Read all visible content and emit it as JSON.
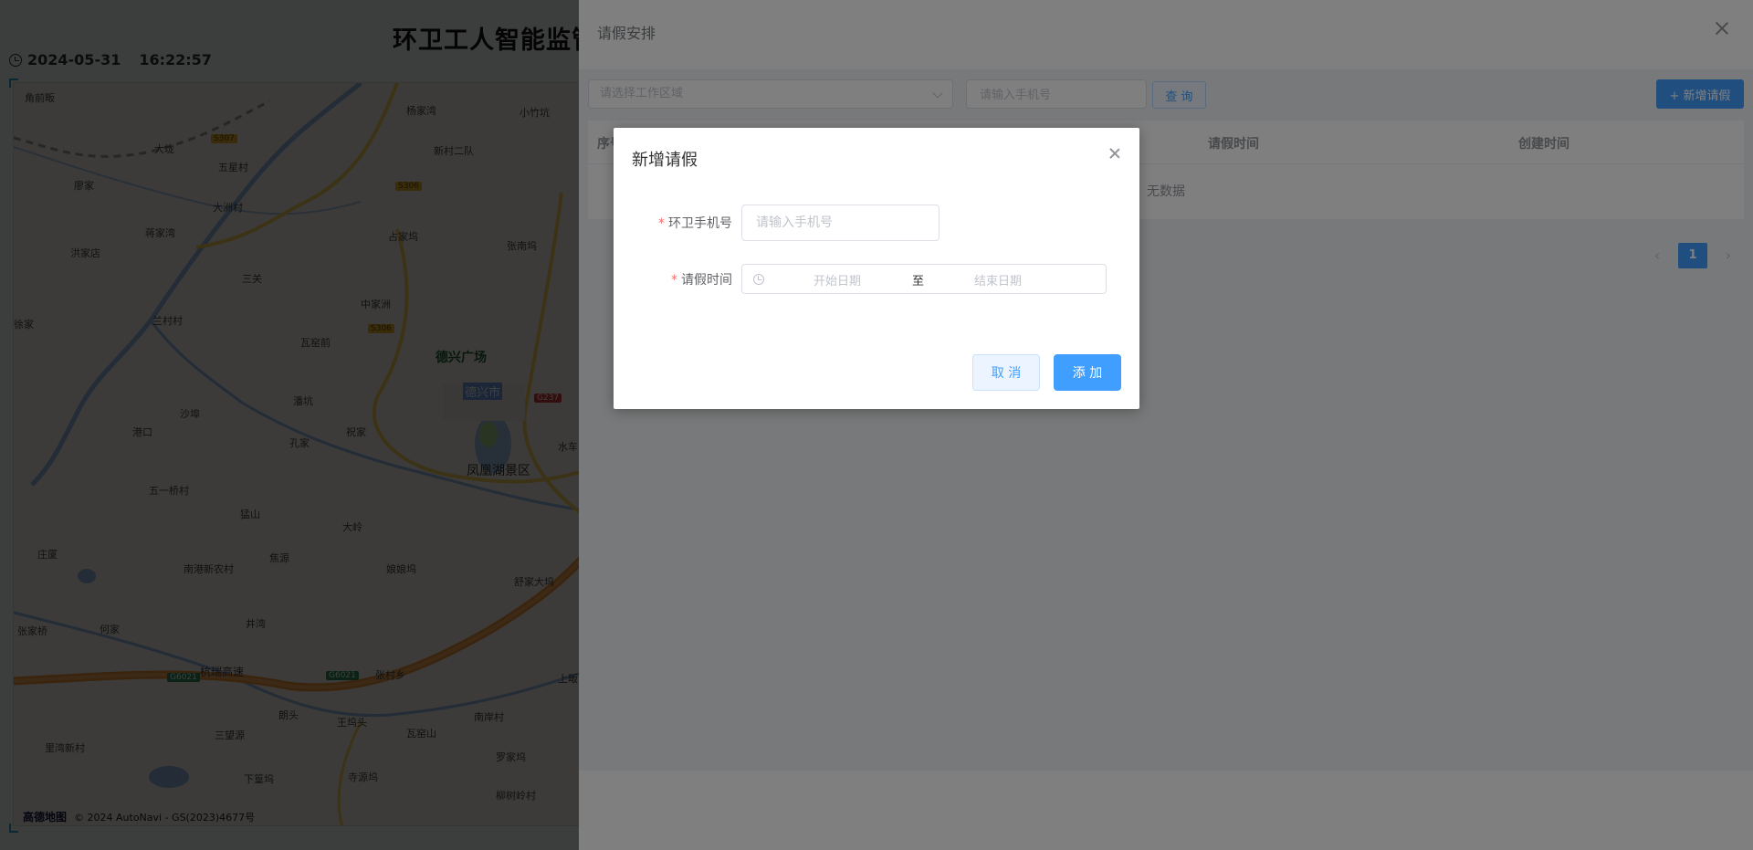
{
  "dashboard": {
    "title": "环卫工人智能监管",
    "date": "2024-05-31",
    "time": "16:22:57",
    "map": {
      "labels": [
        "角前畈",
        "杨家湾",
        "小竹坑",
        "大垅",
        "新村二队",
        "五星村",
        "廖家",
        "大洲村",
        "蒋家湾",
        "占家坞",
        "张南坞",
        "洪家店",
        "三关",
        "兰村村",
        "中家洲",
        "瓦窑前",
        "徐家",
        "潘坑",
        "沙埠",
        "港口",
        "孔家",
        "祝家",
        "水车",
        "五一桥村",
        "猛山",
        "大岭",
        "庄厦",
        "南港新农村",
        "焦源",
        "娘娘坞",
        "舒家大坞",
        "井湾",
        "何家",
        "张家桥",
        "张村乡",
        "朗头",
        "王坞头",
        "上畈",
        "南岸村",
        "三望源",
        "瓦窑山",
        "里湾新村",
        "罗家坞",
        "下篁坞",
        "寺源坞",
        "柳树岭村"
      ],
      "poi": "德兴广场",
      "city": "德兴市",
      "scenic": "凤凰湖景区",
      "highway": "杭瑞高速",
      "shields": [
        "S307",
        "S306",
        "S306",
        "G237",
        "G6021",
        "G6021"
      ],
      "attribution_logo": "高德地图",
      "attribution_text": "© 2024 AutoNavi - GS(2023)4677号"
    }
  },
  "drawer": {
    "title": "请假安排",
    "filters": {
      "area_placeholder": "请选择工作区域",
      "phone_placeholder": "请输入手机号",
      "query_label": "查 询",
      "add_label": "+ 新增请假"
    },
    "table": {
      "columns": [
        "序号",
        "请假时间",
        "创建时间"
      ],
      "empty_text": "无数据"
    },
    "pagination": {
      "prev": "‹",
      "current": "1",
      "next": "›"
    }
  },
  "modal": {
    "title": "新增请假",
    "phone_label": "环卫手机号",
    "phone_placeholder": "请输入手机号",
    "leave_time_label": "请假时间",
    "start_placeholder": "开始日期",
    "separator": "至",
    "end_placeholder": "结束日期",
    "cancel_label": "取 消",
    "submit_label": "添 加",
    "required_mark": "*"
  },
  "colors": {
    "primary": "#409eff",
    "mask": "rgba(0,0,0,0.5)",
    "required": "#f56c6c"
  }
}
